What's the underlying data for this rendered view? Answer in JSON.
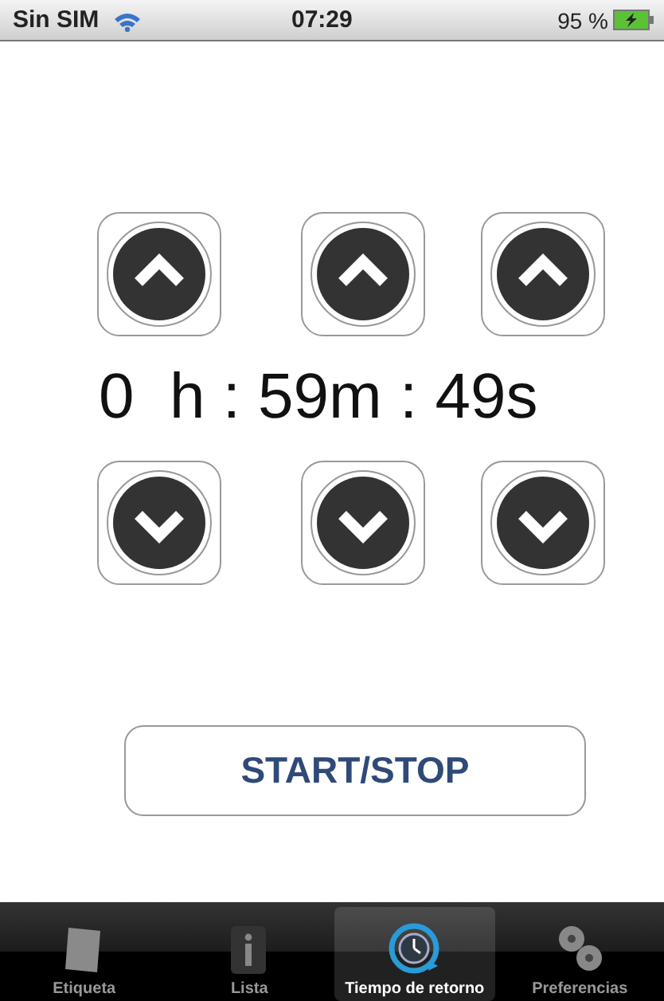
{
  "status_bar": {
    "carrier": "Sin SIM",
    "time": "07:29",
    "battery": "95 %"
  },
  "up_buttons": [
    {
      "kind": "up"
    },
    {
      "kind": "up"
    },
    {
      "kind": "up"
    }
  ],
  "time_display": "0  h : 59m : 49s",
  "down_buttons": [
    {
      "kind": "down"
    },
    {
      "kind": "down"
    },
    {
      "kind": "down"
    }
  ],
  "start_button": "START/STOP",
  "tabs": [
    {
      "label": "Etiqueta",
      "kind": "card",
      "selected": false
    },
    {
      "label": "Lista",
      "kind": "info",
      "selected": false
    },
    {
      "label": "Tiempo de retorno",
      "kind": "clock",
      "selected": true
    },
    {
      "label": "Preferencias",
      "kind": "gears",
      "selected": false
    }
  ]
}
